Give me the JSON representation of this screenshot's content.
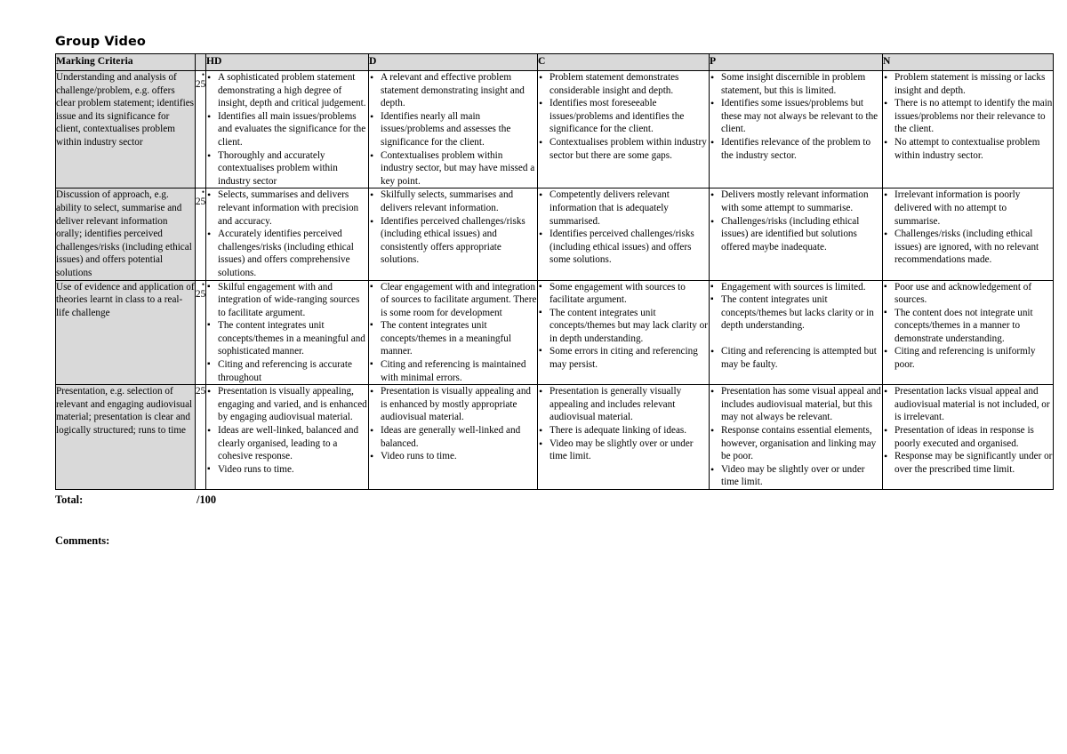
{
  "document": {
    "title": "Group Video",
    "total_label": "Total:",
    "total_value": "/100",
    "comments_label": "Comments:"
  },
  "table": {
    "headers": {
      "criteria": "Marking Criteria",
      "marks": "",
      "hd": "HD",
      "d": "D",
      "c": "C",
      "p": "P",
      "n": "N"
    },
    "rows": [
      {
        "criteria": "Understanding and analysis of challenge/problem, e.g. offers clear problem statement; identifies issue and its significance for client, contextualises problem within industry sector",
        "marks_dot": "•",
        "marks": "25",
        "hd": [
          {
            "bullet": "round",
            "text": "A sophisticated problem statement demonstrating a high degree of insight, depth and critical judgement."
          },
          {
            "bullet": "round",
            "text": "Identifies all main issues/problems and evaluates the significance for the client."
          },
          {
            "bullet": "round",
            "text": "Thoroughly and accurately contextualises problem within industry sector"
          }
        ],
        "d": [
          {
            "bullet": "round",
            "text": "A relevant and effective problem statement demonstrating insight and depth."
          },
          {
            "bullet": "round",
            "text": "Identifies nearly all main issues/problems and assesses the significance for the client."
          },
          {
            "bullet": "round",
            "text": "Contextualises problem within industry sector, but may have missed a key point."
          }
        ],
        "c": [
          {
            "bullet": "round",
            "text": "Problem statement demonstrates considerable insight and depth."
          },
          {
            "bullet": "round",
            "text": "Identifies most foreseeable issues/problems and identifies the significance for the client."
          },
          {
            "bullet": "round",
            "text": "Contextualises problem within industry sector but there are some gaps."
          }
        ],
        "p": [
          {
            "bullet": "round",
            "text": "Some insight discernible in problem statement, but this is limited."
          },
          {
            "bullet": "round",
            "text": "Identifies some issues/problems but these may not always be relevant to the client."
          },
          {
            "bullet": "round",
            "text": "Identifies relevance of the problem to the industry sector."
          }
        ],
        "n": [
          {
            "bullet": "round",
            "text": "Problem statement is missing or lacks insight and depth."
          },
          {
            "bullet": "round",
            "text": "There is no attempt to identify the main issues/problems nor their relevance to the client."
          },
          {
            "bullet": "round",
            "text": "No attempt to contextualise problem within industry sector."
          }
        ]
      },
      {
        "criteria": "Discussion of approach, e.g. ability to select, summarise and deliver relevant information orally; identifies perceived challenges/risks (including ethical issues) and offers potential solutions",
        "marks_dot": "•",
        "marks": "25",
        "hd": [
          {
            "bullet": "round",
            "text": "Selects, summarises and delivers relevant information with precision and accuracy."
          },
          {
            "bullet": "round",
            "text": "Accurately identifies perceived challenges/risks (including ethical issues) and offers comprehensive solutions."
          }
        ],
        "d": [
          {
            "bullet": "round",
            "text": "Skilfully selects, summarises and delivers relevant information."
          },
          {
            "bullet": "round",
            "text": "Identifies perceived challenges/risks (including ethical issues) and consistently offers appropriate solutions."
          }
        ],
        "c": [
          {
            "bullet": "round",
            "text": "Competently delivers relevant information that is adequately summarised."
          },
          {
            "bullet": "round",
            "text": "Identifies perceived challenges/risks (including ethical issues) and offers some solutions."
          }
        ],
        "p": [
          {
            "bullet": "round",
            "text": "Delivers mostly relevant information with some attempt to summarise."
          },
          {
            "bullet": "round",
            "text": "Challenges/risks (including ethical issues) are identified but solutions offered maybe inadequate."
          }
        ],
        "n": [
          {
            "bullet": "round",
            "text": "Irrelevant information is poorly delivered with no attempt to summarise."
          },
          {
            "bullet": "round",
            "text": "Challenges/risks (including ethical issues) are ignored, with no relevant recommendations made."
          }
        ]
      },
      {
        "criteria": "Use of evidence and application of theories learnt in class to a real-life challenge",
        "marks_dot": "•",
        "marks": "25",
        "hd": [
          {
            "bullet": "square",
            "text": "Skilful engagement with and integration of wide-ranging sources to facilitate argument."
          },
          {
            "bullet": "square",
            "text": "The content integrates unit concepts/themes in a meaningful and sophisticated manner."
          },
          {
            "bullet": "square",
            "text": "Citing and referencing is accurate throughout"
          }
        ],
        "d": [
          {
            "bullet": "square",
            "text": "Clear engagement with and integration of sources to facilitate argument. There is some room for development"
          },
          {
            "bullet": "square",
            "text": "The content integrates unit concepts/themes in a meaningful manner."
          },
          {
            "bullet": "square",
            "text": "Citing and referencing is maintained with minimal errors."
          }
        ],
        "c": [
          {
            "bullet": "square",
            "text": "Some engagement with sources to facilitate argument."
          },
          {
            "bullet": "square",
            "text": "The content integrates unit concepts/themes but may lack clarity or in depth understanding."
          },
          {
            "bullet": "square",
            "text": "Some errors in citing and referencing may persist."
          }
        ],
        "p": [
          {
            "bullet": "square",
            "text": "Engagement with sources is limited."
          },
          {
            "bullet": "square",
            "text": "The content integrates unit concepts/themes but lacks clarity or in depth understanding."
          },
          {
            "bullet": "round",
            "gap": true,
            "text": "Citing and referencing is attempted but may be faulty."
          }
        ],
        "n": [
          {
            "bullet": "square",
            "text": "Poor use and acknowledgement of sources."
          },
          {
            "bullet": "square",
            "text": "The content does not integrate unit concepts/themes in a manner to demonstrate understanding."
          },
          {
            "bullet": "round",
            "text": "Citing and referencing is uniformly poor."
          }
        ]
      },
      {
        "criteria": "Presentation, e.g. selection of relevant and engaging audiovisual material; presentation is clear and logically structured; runs to time",
        "marks_dot": "",
        "marks": "25",
        "hd": [
          {
            "bullet": "round",
            "text": "Presentation is visually appealing, engaging and varied, and is enhanced by engaging audiovisual material."
          },
          {
            "bullet": "round",
            "text": "Ideas are well-linked, balanced and clearly organised, leading to a cohesive response."
          },
          {
            "bullet": "square",
            "text": "Video runs to time."
          }
        ],
        "d": [
          {
            "bullet": "round",
            "text": "Presentation is visually appealing and is enhanced by mostly appropriate audiovisual material."
          },
          {
            "bullet": "round",
            "text": "Ideas are generally well-linked and balanced."
          },
          {
            "bullet": "round",
            "text": "Video runs to time."
          }
        ],
        "c": [
          {
            "bullet": "round",
            "text": "Presentation is generally visually appealing and includes relevant audiovisual material."
          },
          {
            "bullet": "round",
            "text": "There is adequate linking of ideas."
          },
          {
            "bullet": "round",
            "text": "Video may be slightly over or under time limit."
          }
        ],
        "p": [
          {
            "bullet": "round",
            "text": "Presentation has some visual appeal and includes audiovisual material, but this may not always be relevant."
          },
          {
            "bullet": "round",
            "text": "Response contains essential elements, however, organisation and linking may be poor."
          },
          {
            "bullet": "round",
            "text": "Video may be slightly over or under time limit."
          }
        ],
        "n": [
          {
            "bullet": "round",
            "text": "Presentation lacks visual appeal and audiovisual material is not included, or is irrelevant."
          },
          {
            "bullet": "round",
            "text": "Presentation of ideas in response is poorly executed and organised."
          },
          {
            "bullet": "round",
            "text": "Response may be significantly under or over the prescribed time limit."
          }
        ]
      }
    ]
  }
}
